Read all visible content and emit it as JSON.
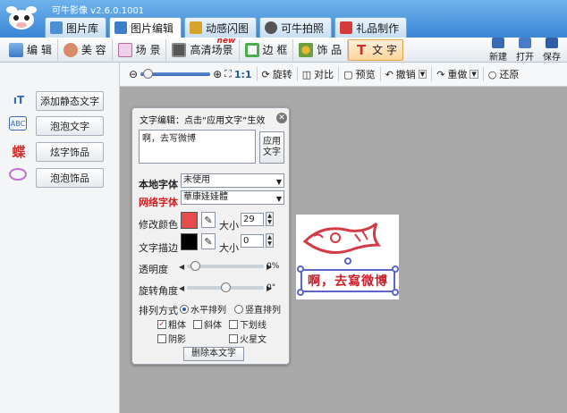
{
  "app": {
    "title": "可牛影像  v2.6.0.1001"
  },
  "main_tabs": [
    {
      "label": "图片库",
      "icon": "gallery-icon",
      "color": "#4e8fd3"
    },
    {
      "label": "图片编辑",
      "icon": "photo-edit-icon",
      "color": "#3d7ec8"
    },
    {
      "label": "动感闪图",
      "icon": "flash-gif-icon",
      "color": "#d5a428"
    },
    {
      "label": "可牛拍照",
      "icon": "camera-icon",
      "color": "#555555"
    },
    {
      "label": "礼品制作",
      "icon": "gift-icon",
      "color": "#d63a3a"
    }
  ],
  "edit_tools": [
    {
      "label": "编 辑",
      "icon": "edit-icon"
    },
    {
      "label": "美 容",
      "icon": "beauty-icon"
    },
    {
      "label": "场 景",
      "icon": "scene-icon"
    },
    {
      "label": "高清场景",
      "icon": "hd-scene-icon",
      "badge": "new"
    },
    {
      "label": "边 框",
      "icon": "frame-icon"
    },
    {
      "label": "饰 品",
      "icon": "accessory-icon"
    },
    {
      "label": "文 字",
      "icon": "text-tool-icon"
    }
  ],
  "right_tools": [
    {
      "label": "新建",
      "icon": "new-file-icon"
    },
    {
      "label": "打开",
      "icon": "open-folder-icon"
    },
    {
      "label": "保存",
      "icon": "save-icon"
    }
  ],
  "left_panel": [
    {
      "label": "添加静态文字",
      "icon": "static-text-icon"
    },
    {
      "label": "泡泡文字",
      "icon": "bubble-text-icon"
    },
    {
      "label": "炫字饰品",
      "icon": "fancy-text-icon"
    },
    {
      "label": "泡泡饰品",
      "icon": "bubble-decor-icon"
    }
  ],
  "view_toolbar": {
    "zoom_fit_label": "1:1",
    "rotate_label": "旋转",
    "compare_label": "对比",
    "preview_label": "预览",
    "undo_label": "撤销",
    "redo_label": "重做",
    "restore_label": "还原",
    "zoom_level": 0.05
  },
  "dialog": {
    "title": "文字编辑：点击“应用文字”生效",
    "text_value": "啊，去写微博",
    "apply_label": "应用\n文字",
    "local_font_label": "本地字体",
    "local_font_value": "未使用",
    "web_font_label": "网络字体",
    "web_font_value": "華康娃娃體",
    "color_label": "修改颜色",
    "color_value": "#e74c4c",
    "size_label": "大小",
    "size_value": "29",
    "stroke_label": "文字描边",
    "stroke_color": "#000000",
    "stroke_size_label": "大小",
    "stroke_size_value": "0",
    "opacity_label": "透明度",
    "opacity_value_label": "0%",
    "opacity_value": 0.05,
    "rotate_label": "旋转角度",
    "rotate_value_label": "0°",
    "rotate_value": 0.5,
    "layout_label": "排列方式",
    "layout_horizontal": "水平排列",
    "layout_vertical": "竖直排列",
    "bold": "粗体",
    "italic": "斜体",
    "underline": "下划线",
    "shadow": "阴影",
    "mars_text": "火星文",
    "delete_label": "删除本文字"
  },
  "canvas": {
    "caption_text": "啊，去寫微博",
    "text_color": "#c8202a"
  }
}
